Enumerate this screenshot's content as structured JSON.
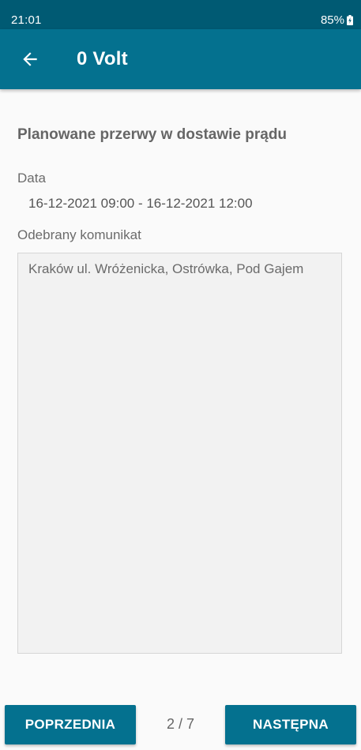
{
  "status_bar": {
    "time": "21:01",
    "battery": "85%"
  },
  "app_bar": {
    "title": "0 Volt",
    "back_icon": "arrow-left-icon"
  },
  "content": {
    "section_title": "Planowane przerwy w dostawie prądu",
    "date_label": "Data",
    "date_value": "16-12-2021 09:00 - 16-12-2021 12:00",
    "message_label": "Odebrany komunikat",
    "message_text": "Kraków ul. Wróżenicka, Ostrówka, Pod Gajem"
  },
  "navigation": {
    "prev_label": "POPRZEDNIA",
    "next_label": "NASTĘPNA",
    "page_indicator": "2 / 7"
  },
  "colors": {
    "status_bar": "#005a73",
    "app_bar": "#04718f",
    "button": "#04718f",
    "background": "#fafafa"
  }
}
